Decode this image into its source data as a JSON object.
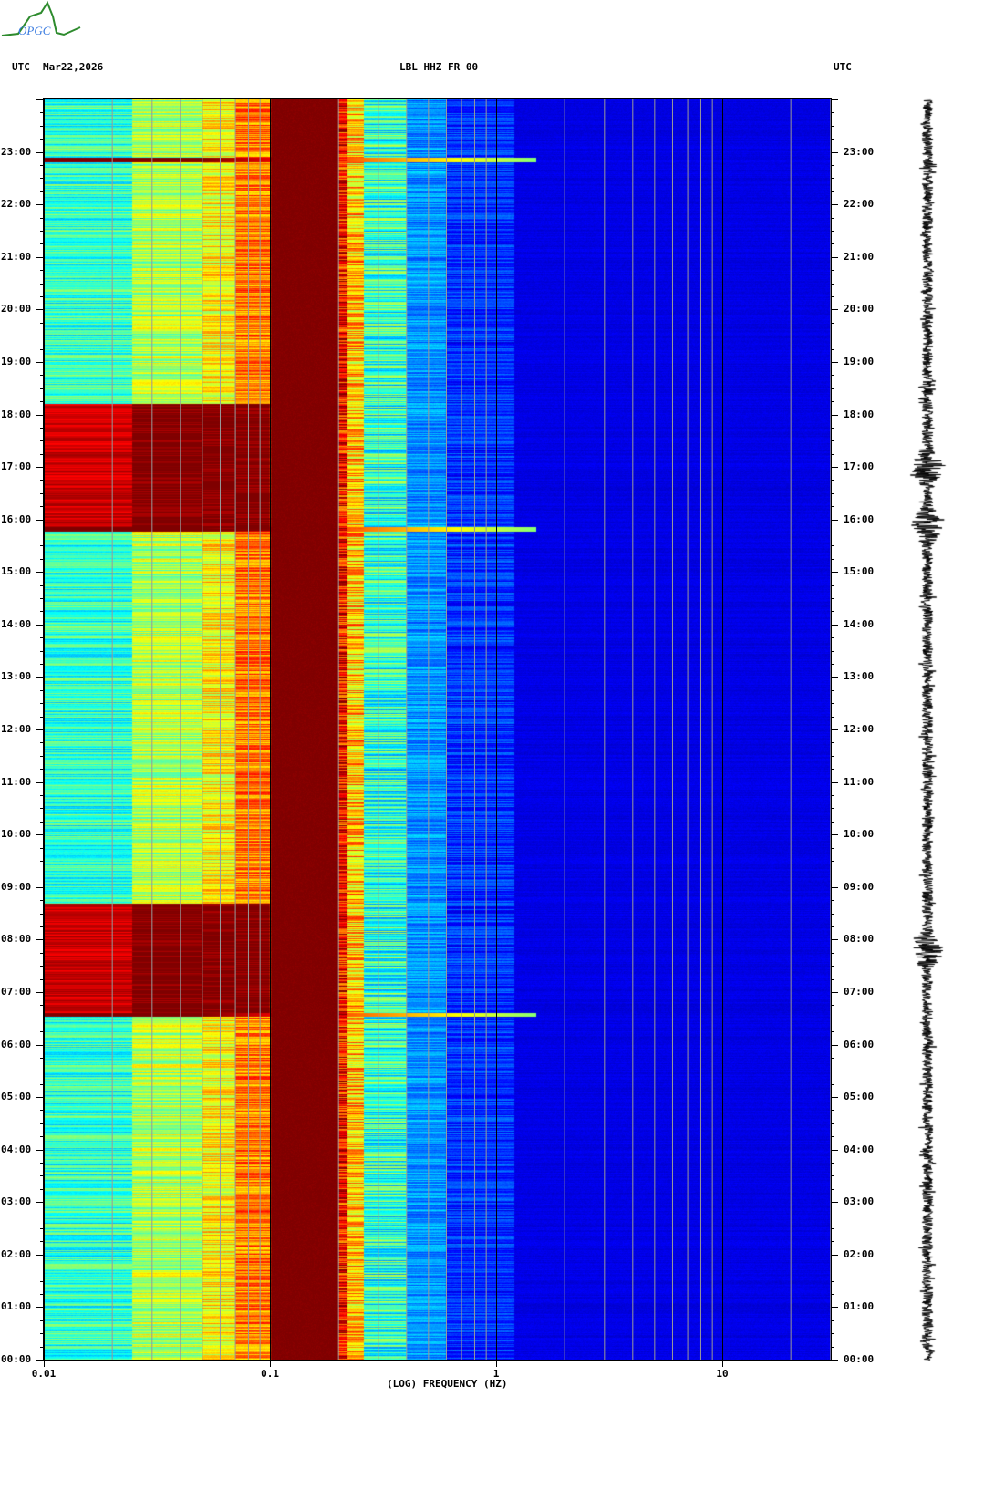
{
  "header": {
    "left_tz": "UTC",
    "date": "Mar22,2026",
    "station": "LBL HHZ FR 00",
    "right_tz": "UTC"
  },
  "logo": {
    "text": "OPGC"
  },
  "chart_data": {
    "type": "heatmap",
    "title": "LBL HHZ FR 00",
    "xlabel": "(LOG) FREQUENCY (HZ)",
    "ylabel": "UTC",
    "xscale": "log",
    "xlim": [
      0.01,
      30
    ],
    "ylim": [
      0,
      24
    ],
    "x_ticks": [
      {
        "v": 0.01,
        "label": "0.01"
      },
      {
        "v": 0.1,
        "label": "0.1"
      },
      {
        "v": 1,
        "label": "1"
      },
      {
        "v": 10,
        "label": "10"
      }
    ],
    "y_ticks": [
      "00:00",
      "01:00",
      "02:00",
      "03:00",
      "04:00",
      "05:00",
      "06:00",
      "07:00",
      "08:00",
      "09:00",
      "10:00",
      "11:00",
      "12:00",
      "13:00",
      "14:00",
      "15:00",
      "16:00",
      "17:00",
      "18:00",
      "19:00",
      "20:00",
      "21:00",
      "22:00",
      "23:00"
    ],
    "colormap": "jet",
    "bands": [
      {
        "f_lo": 0.01,
        "f_hi": 0.0245,
        "level": 0.42
      },
      {
        "f_lo": 0.0245,
        "f_hi": 0.05,
        "level": 0.55
      },
      {
        "f_lo": 0.05,
        "f_hi": 0.07,
        "level": 0.63
      },
      {
        "f_lo": 0.07,
        "f_hi": 0.1,
        "level": 0.75
      },
      {
        "f_lo": 0.1,
        "f_hi": 0.2,
        "level": 1.0
      },
      {
        "f_lo": 0.2,
        "f_hi": 0.22,
        "level": 0.86
      },
      {
        "f_lo": 0.22,
        "f_hi": 0.26,
        "level": 0.68
      },
      {
        "f_lo": 0.26,
        "f_hi": 0.4,
        "level": 0.42
      },
      {
        "f_lo": 0.4,
        "f_hi": 0.6,
        "level": 0.27
      },
      {
        "f_lo": 0.6,
        "f_hi": 1.2,
        "level": 0.17
      },
      {
        "f_lo": 1.2,
        "f_hi": 30,
        "level": 0.1
      }
    ],
    "high_noise_intervals_hours": [
      [
        15.8,
        18.2
      ],
      [
        6.6,
        8.7
      ]
    ],
    "events_hours": [
      6.57,
      15.82,
      22.85
    ],
    "seismogram_bursts_hours": [
      17.0,
      7.8,
      15.9
    ]
  }
}
